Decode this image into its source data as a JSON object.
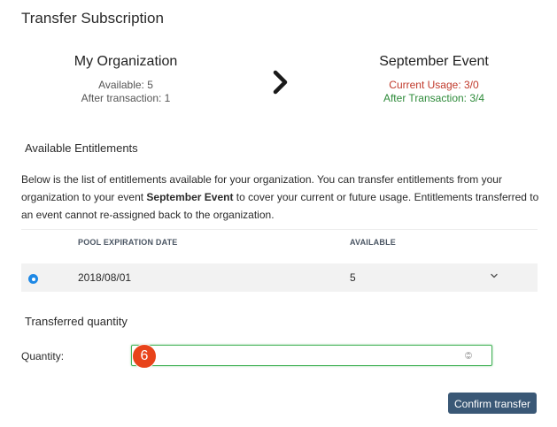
{
  "header": {
    "title": "Transfer Subscription"
  },
  "organization": {
    "name": "My Organization",
    "available": "Available: 5",
    "after_transaction": "After transaction: 1"
  },
  "event": {
    "name": "September Event",
    "current_usage": "Current Usage: 3/0",
    "after_transaction": "After Transaction: 3/4"
  },
  "entitlements": {
    "heading": "Available Entitlements",
    "description_part1": "Below is the list of entitlements available for your organization. You can transfer entitlements from your organization to your event ",
    "description_event": "September Event",
    "description_part2": " to cover your current or future usage. Entitlements transferred to an event cannot re-assigned back to the organization.",
    "columns": [
      "POOL EXPIRATION DATE",
      "AVAILABLE"
    ],
    "rows": [
      {
        "date": "2018/08/01",
        "available": "5",
        "selected": true
      }
    ]
  },
  "transfer": {
    "heading": "Transferred quantity",
    "quantity_label": "Quantity:",
    "quantity_badge": "6",
    "confirm_label": "Confirm transfer"
  },
  "colors": {
    "accent": "#1e88e5",
    "button": "#3a5876",
    "badge": "#e8431a",
    "usage_red": "#c0392b",
    "after_green": "#2e8b3a",
    "input_border": "#46b35a"
  },
  "icons": [
    "chevron-right-icon",
    "chevron-down-icon",
    "radio-selected-icon",
    "stepper-icon"
  ]
}
